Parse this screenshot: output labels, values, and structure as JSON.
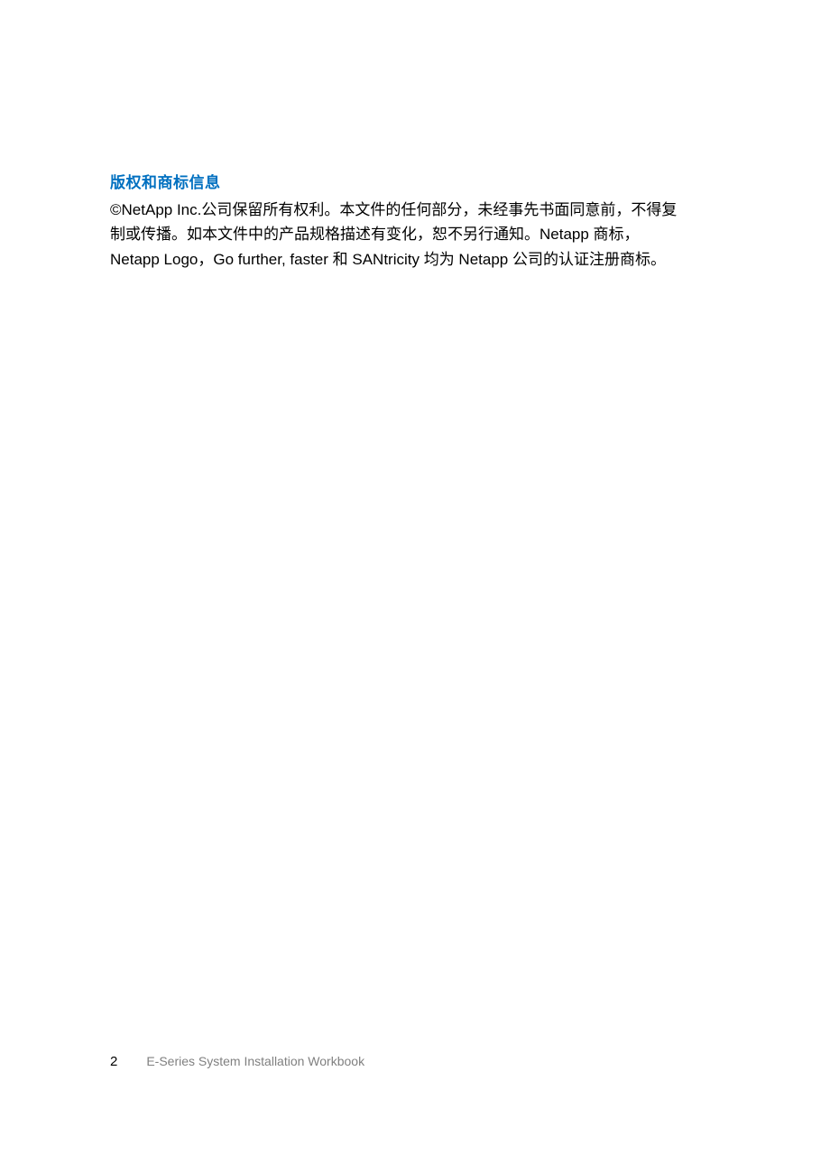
{
  "heading": "版权和商标信息",
  "body": {
    "line1": "©NetApp Inc.公司保留所有权利。本文件的任何部分，未经事先书面同意前，不得复",
    "line2": "制或传播。如本文件中的产品规格描述有变化，恕不另行通知。Netapp 商标，",
    "line3": "Netapp Logo，Go further, faster 和 SANtricity 均为 Netapp 公司的认证注册商标。"
  },
  "footer": {
    "page_number": "2",
    "title": "E-Series System Installation Workbook"
  }
}
